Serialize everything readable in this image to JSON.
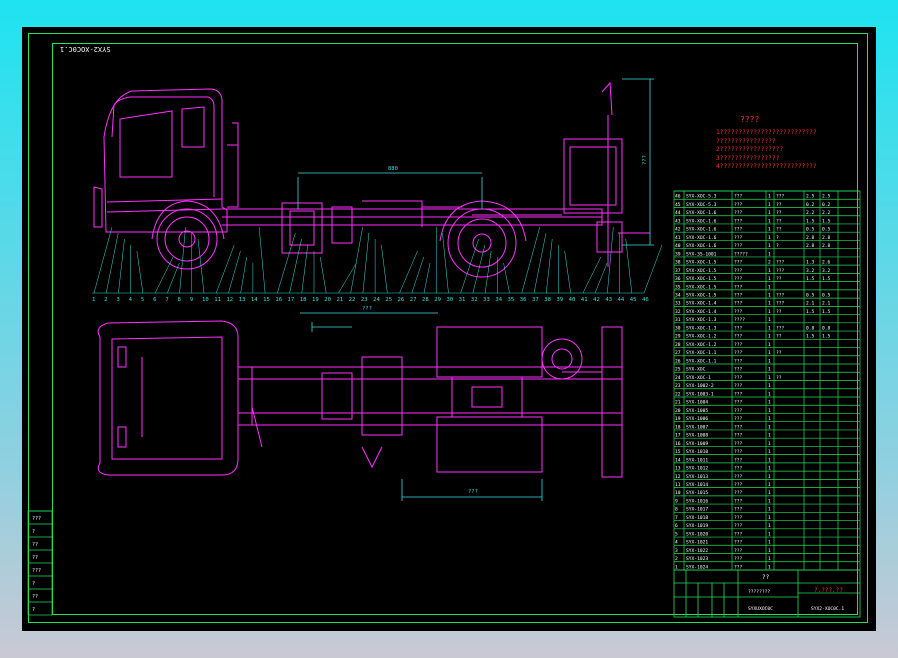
{
  "colors": {
    "background": "#000000",
    "frame": "#21e05a",
    "geometry": "#ff30ff",
    "dimension": "#34e0e0",
    "text": "#ffffff",
    "note": "#ff3030"
  },
  "drawing": {
    "corner_code": "SYX2-XOC0C.1",
    "note_title": "????",
    "notes": [
      "1??????????????????????????",
      "   ????????????????",
      "2?????????????????",
      "3????????????????",
      "4??????????????????????????"
    ],
    "balloons_top": [
      "1",
      "2",
      "3",
      "4",
      "5",
      "6",
      "7",
      "8",
      "9",
      "10",
      "11",
      "12",
      "13",
      "14",
      "15",
      "16",
      "17",
      "18",
      "19",
      "20",
      "21",
      "22",
      "23",
      "24",
      "25",
      "26",
      "27",
      "28",
      "29",
      "30",
      "31",
      "32",
      "33",
      "34",
      "35",
      "36",
      "37",
      "38",
      "39",
      "40",
      "41",
      "42",
      "43",
      "44",
      "45",
      "46"
    ],
    "dims_top": [
      "880",
      "???"
    ],
    "dims_bottom": [
      "???",
      "???"
    ]
  },
  "bom": {
    "rows": [
      [
        "46",
        "SYX-XOC-5.3",
        "???",
        "1",
        "???",
        "2.5",
        "2.5"
      ],
      [
        "45",
        "SYX-XOC-5.3",
        "???",
        "1",
        "??",
        "0.2",
        "0.2"
      ],
      [
        "44",
        "SYX-XOC-1.6",
        "???",
        "1",
        "??",
        "2.2",
        "2.2"
      ],
      [
        "43",
        "SYX-XOC-1.6",
        "???",
        "1",
        "??",
        "1.5",
        "1.5"
      ],
      [
        "42",
        "SYX-XOC-1.6",
        "???",
        "1",
        "??",
        "0.5",
        "0.5"
      ],
      [
        "41",
        "SYX-XOC-1.6",
        "???",
        "1",
        "?",
        "2.8",
        "2.8"
      ],
      [
        "40",
        "SYX-XOC-1.6",
        "???",
        "1",
        "?",
        "2.8",
        "2.8"
      ],
      [
        "39",
        "SYX-35-1001",
        "?????",
        "1",
        "",
        "",
        ""
      ],
      [
        "38",
        "SYX-XOC-1.5",
        "???",
        "2",
        "???",
        "1.3",
        "2.6"
      ],
      [
        "37",
        "SYX-XOC-1.5",
        "???",
        "1",
        "???",
        "3.2",
        "3.2"
      ],
      [
        "36",
        "SYX-XOC-1.5",
        "???",
        "1",
        "??",
        "1.5",
        "1.5"
      ],
      [
        "35",
        "SYX-XOC-1.5",
        "???",
        "1",
        "",
        "",
        ""
      ],
      [
        "34",
        "SYX-XOC-1.5",
        "???",
        "1",
        "???",
        "0.5",
        "0.5"
      ],
      [
        "33",
        "SYX-XOC-1.4",
        "???",
        "1",
        "???",
        "2.1",
        "2.1"
      ],
      [
        "32",
        "SYX-XOC-1.4",
        "???",
        "1",
        "??",
        "1.5",
        "1.5"
      ],
      [
        "31",
        "SYX-XOC-1.3",
        "????",
        "1",
        "",
        "",
        ""
      ],
      [
        "30",
        "SYX-XOC-1.3",
        "???",
        "1",
        "???",
        "0.8",
        "0.8"
      ],
      [
        "29",
        "SYX-XOC-1.2",
        "???",
        "1",
        "??",
        "1.5",
        "1.5"
      ],
      [
        "28",
        "SYX-XOC-1.2",
        "???",
        "1",
        "",
        "",
        ""
      ],
      [
        "27",
        "SYX-XOC-1.1",
        "???",
        "1",
        "??",
        "",
        ""
      ],
      [
        "26",
        "SYX-XOC-1.1",
        "???",
        "1",
        "",
        "",
        ""
      ],
      [
        "25",
        "SYX-XOC",
        "???",
        "1",
        "",
        "",
        ""
      ],
      [
        "24",
        "SYX-XOC-1",
        "???",
        "1",
        "??",
        "",
        ""
      ],
      [
        "23",
        "SYX-1002-2",
        "???",
        "1",
        "",
        "",
        ""
      ],
      [
        "22",
        "SYX-1003-1",
        "???",
        "1",
        "",
        "",
        ""
      ],
      [
        "21",
        "SYX-1004",
        "???",
        "1",
        "",
        "",
        ""
      ],
      [
        "20",
        "SYX-1005",
        "???",
        "1",
        "",
        "",
        ""
      ],
      [
        "19",
        "SYX-1006",
        "???",
        "1",
        "",
        "",
        ""
      ],
      [
        "18",
        "SYX-1007",
        "???",
        "1",
        "",
        "",
        ""
      ],
      [
        "17",
        "SYX-1008",
        "???",
        "1",
        "",
        "",
        ""
      ],
      [
        "16",
        "SYX-1009",
        "???",
        "1",
        "",
        "",
        ""
      ],
      [
        "15",
        "SYX-1010",
        "???",
        "1",
        "",
        "",
        ""
      ],
      [
        "14",
        "SYX-1011",
        "???",
        "1",
        "",
        "",
        ""
      ],
      [
        "13",
        "SYX-1012",
        "???",
        "1",
        "",
        "",
        ""
      ],
      [
        "12",
        "SYX-1013",
        "???",
        "1",
        "",
        "",
        ""
      ],
      [
        "11",
        "SYX-1014",
        "???",
        "1",
        "",
        "",
        ""
      ],
      [
        "10",
        "SYX-1015",
        "???",
        "1",
        "",
        "",
        ""
      ],
      [
        "9",
        "SYX-1016",
        "???",
        "1",
        "",
        "",
        ""
      ],
      [
        "8",
        "SYX-1017",
        "???",
        "1",
        "",
        "",
        ""
      ],
      [
        "7",
        "SYX-1018",
        "???",
        "1",
        "",
        "",
        ""
      ],
      [
        "6",
        "SYX-1019",
        "???",
        "1",
        "",
        "",
        ""
      ],
      [
        "5",
        "SYX-1020",
        "???",
        "1",
        "",
        "",
        ""
      ],
      [
        "4",
        "SYX-1021",
        "???",
        "1",
        "",
        "",
        ""
      ],
      [
        "3",
        "SYX-1022",
        "???",
        "1",
        "",
        "",
        ""
      ],
      [
        "2",
        "SYX-1023",
        "???",
        "1",
        "",
        "",
        ""
      ],
      [
        "1",
        "SYX-1024",
        "???",
        "1",
        "",
        "",
        ""
      ]
    ],
    "title_block": {
      "name": "??",
      "material": "????????",
      "company": "?.???.??",
      "drawing_no": "SYX2-XOC0C.1",
      "code": "SYXUXOC0C"
    }
  },
  "left_block": [
    "???",
    "?",
    "??",
    "??",
    "???",
    "?",
    "??",
    "?"
  ]
}
